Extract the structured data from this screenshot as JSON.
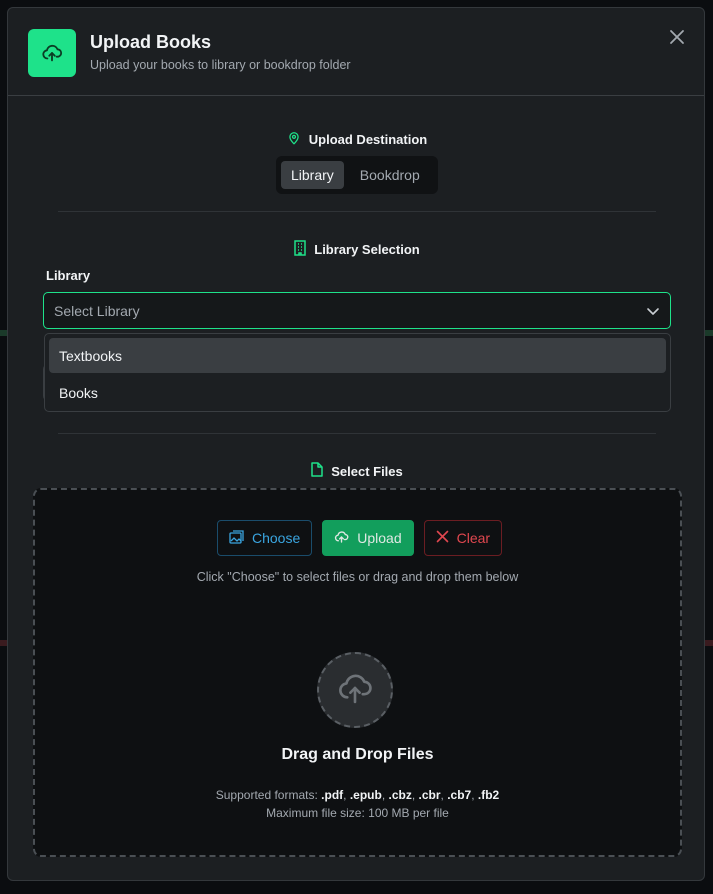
{
  "header": {
    "title": "Upload Books",
    "subtitle": "Upload your books to library or bookdrop folder"
  },
  "destination": {
    "title": "Upload Destination",
    "options": [
      "Library",
      "Bookdrop"
    ],
    "selected": "Library"
  },
  "library_selection": {
    "title": "Library Selection",
    "field_label": "Library",
    "placeholder": "Select Library",
    "options": [
      "Textbooks",
      "Books"
    ]
  },
  "files": {
    "title": "Select Files",
    "choose_label": "Choose",
    "upload_label": "Upload",
    "clear_label": "Clear",
    "hint": "Click \"Choose\" to select files or drag and drop them below",
    "drop_title": "Drag and Drop Files",
    "formats_prefix": "Supported formats:",
    "formats": [
      ".pdf",
      ".epub",
      ".cbz",
      ".cbr",
      ".cb7",
      ".fb2"
    ],
    "max_size": "Maximum file size: 100 MB per file"
  },
  "colors": {
    "accent": "#1ee28a",
    "choose": "#3aa5e0",
    "upload": "#129e5c",
    "clear": "#e0474f"
  }
}
